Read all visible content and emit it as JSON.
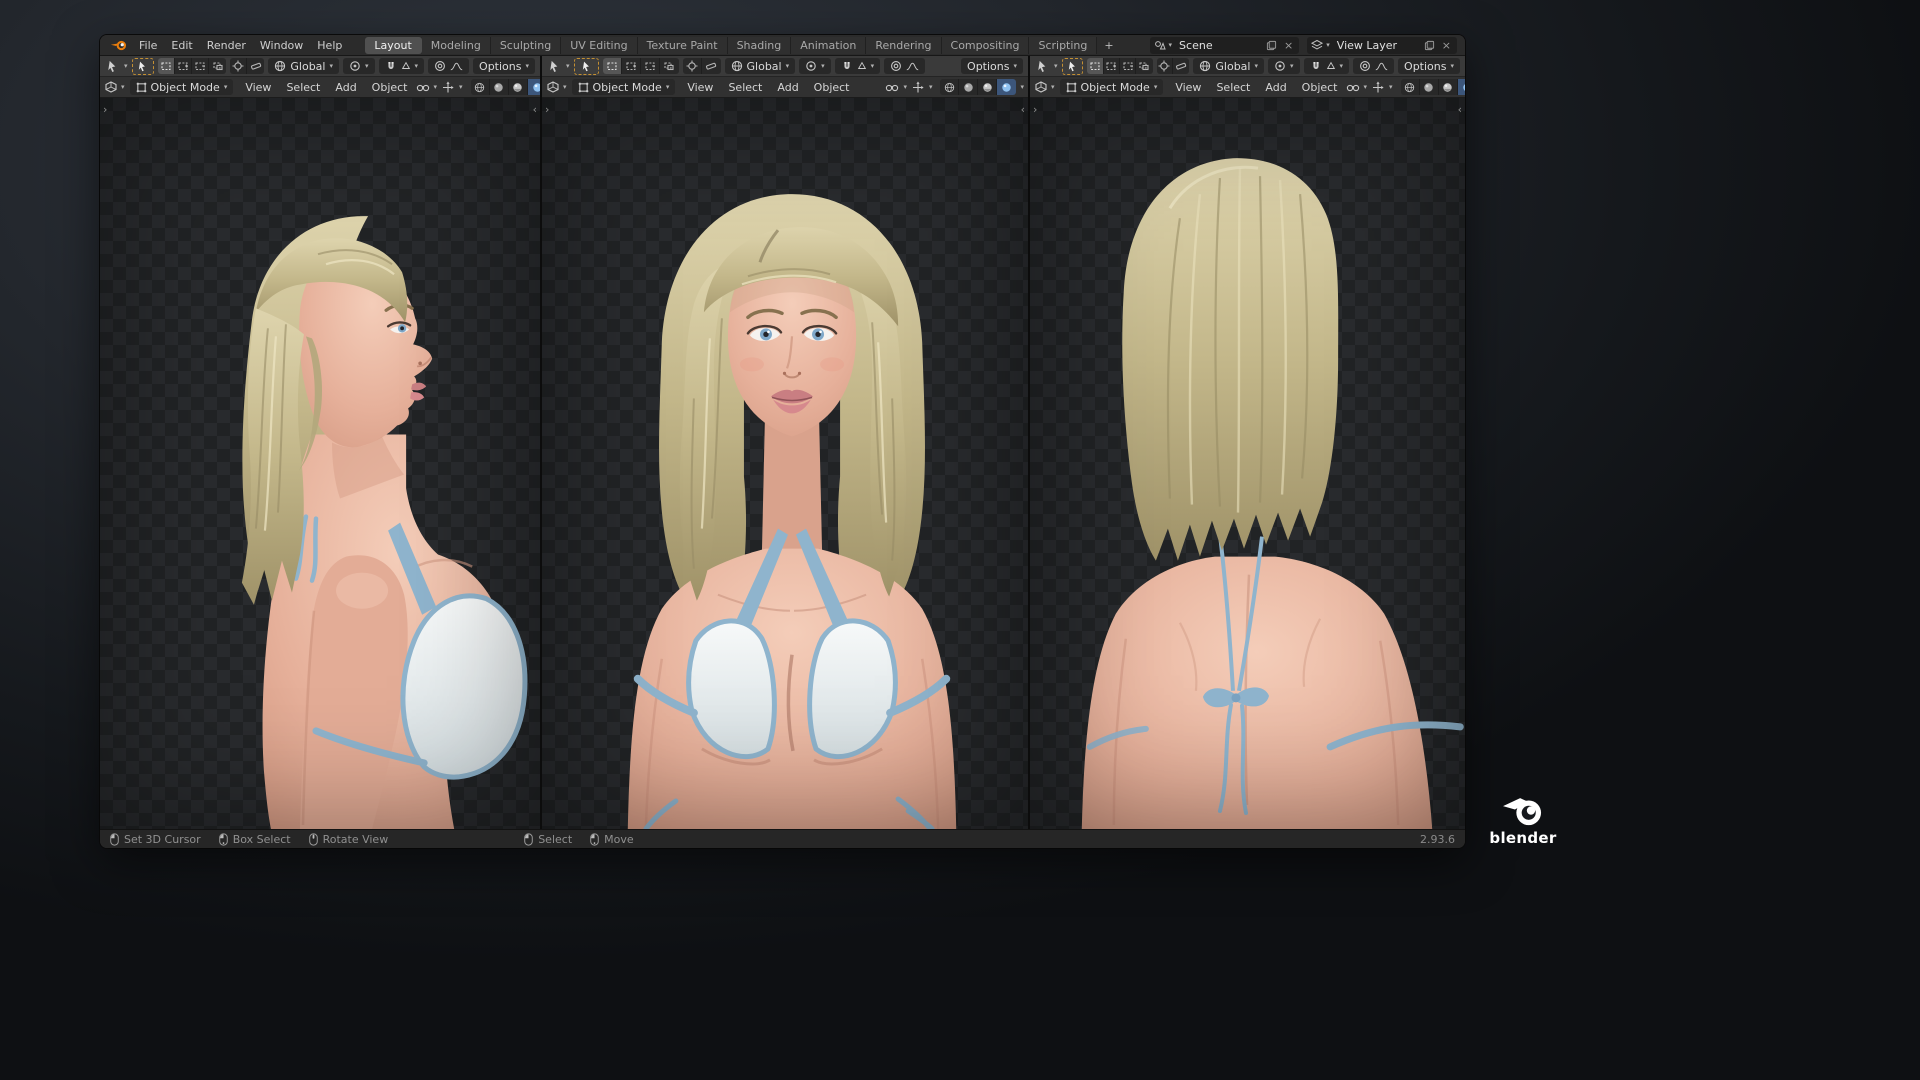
{
  "topbar": {
    "menus": [
      "File",
      "Edit",
      "Render",
      "Window",
      "Help"
    ],
    "tabs": [
      "Layout",
      "Modeling",
      "Sculpting",
      "UV Editing",
      "Texture Paint",
      "Shading",
      "Animation",
      "Rendering",
      "Compositing",
      "Scripting"
    ],
    "add_tab": "+",
    "scene": "Scene",
    "view_layer": "View Layer"
  },
  "tool_settings": {
    "orientation": "Global",
    "options": "Options"
  },
  "viewport": {
    "mode": "Object Mode",
    "menus": [
      "View",
      "Select",
      "Add",
      "Object"
    ]
  },
  "statusbar": {
    "hints": [
      "Set 3D Cursor",
      "Box Select",
      "Rotate View",
      "Select",
      "Move"
    ],
    "version": "2.93.6"
  },
  "brand": {
    "wordmark": "blender"
  },
  "icons": {
    "caret": "▾",
    "close": "×",
    "chev_l": "‹",
    "chev_r": "›"
  },
  "colors": {
    "accent_orange": "#e87d0d",
    "accent_blue": "#4772b3",
    "active_tool_outline": "#c49033",
    "hair": "#cfc49c",
    "skin": "#e8b4a0",
    "bikini": "#edf1f2",
    "bikini_trim": "#8fb4cd"
  }
}
